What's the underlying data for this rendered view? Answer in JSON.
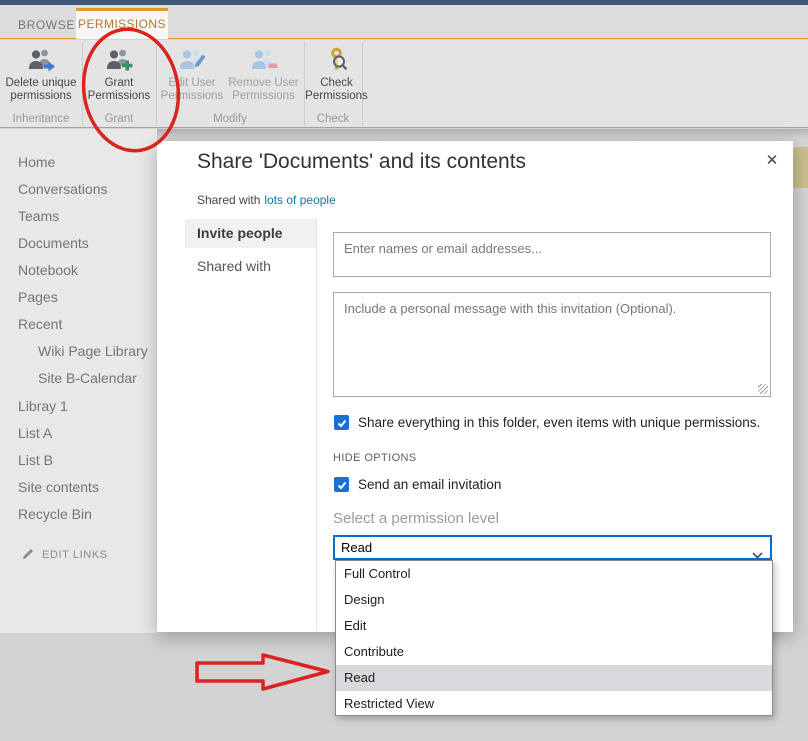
{
  "ribbon": {
    "tabs": [
      {
        "label": "BROWSE",
        "active": false
      },
      {
        "label": "PERMISSIONS",
        "active": true
      }
    ],
    "buttons": [
      {
        "label": "Delete unique\npermissions",
        "icon": "delete-unique-permissions-icon",
        "enabled": true
      },
      {
        "label": "Grant\nPermissions",
        "icon": "grant-permissions-icon",
        "enabled": true
      },
      {
        "label": "Edit User\nPermissions",
        "icon": "edit-user-permissions-icon",
        "enabled": false
      },
      {
        "label": "Remove User\nPermissions",
        "icon": "remove-user-permissions-icon",
        "enabled": false
      },
      {
        "label": "Check\nPermissions",
        "icon": "check-permissions-icon",
        "enabled": true
      }
    ],
    "groups": [
      {
        "label": "Inheritance"
      },
      {
        "label": "Grant"
      },
      {
        "label": "Modify"
      },
      {
        "label": "Check"
      }
    ]
  },
  "sidebar": {
    "items": [
      {
        "label": "Home"
      },
      {
        "label": "Conversations"
      },
      {
        "label": "Teams"
      },
      {
        "label": "Documents"
      },
      {
        "label": "Notebook"
      },
      {
        "label": "Pages"
      },
      {
        "label": "Recent"
      },
      {
        "label": "Wiki Page Library",
        "indent": true
      },
      {
        "label": "Site B-Calendar",
        "indent": true
      },
      {
        "label": "Libray 1"
      },
      {
        "label": "List A"
      },
      {
        "label": "List B"
      },
      {
        "label": "Site contents"
      },
      {
        "label": "Recycle Bin"
      }
    ],
    "edit_links_label": "EDIT LINKS"
  },
  "dialog": {
    "title": "Share 'Documents' and its contents",
    "close_label": "✕",
    "shared_with_prefix": "Shared with",
    "shared_with_link": "lots of people",
    "nav": [
      {
        "label": "Invite people",
        "active": true
      },
      {
        "label": "Shared with",
        "active": false
      }
    ],
    "name_input_placeholder": "Enter names or email addresses...",
    "message_placeholder": "Include a personal message with this invitation (Optional).",
    "checkbox_share_everything": {
      "label": "Share everything in this folder, even items with unique permissions.",
      "checked": true
    },
    "hide_options_label": "HIDE OPTIONS",
    "checkbox_send_email": {
      "label": "Send an email invitation",
      "checked": true
    },
    "permission_label": "Select a permission level",
    "select_value": "Read",
    "dropdown_options": [
      {
        "label": "Full Control",
        "selected": false
      },
      {
        "label": "Design",
        "selected": false
      },
      {
        "label": "Edit",
        "selected": false
      },
      {
        "label": "Contribute",
        "selected": false
      },
      {
        "label": "Read",
        "selected": true
      },
      {
        "label": "Restricted View",
        "selected": false
      }
    ]
  },
  "colors": {
    "suite_bar": "#3d5977",
    "ribbon_accent_orange": "#d89c30",
    "active_tab_text": "#b5772e",
    "link_teal": "#0e76a8",
    "checkbox_blue": "#1a6fd4",
    "select_focus_blue": "#0d6bcd",
    "dropdown_highlight": "#d8d9dc",
    "annotation_red": "#da2420"
  }
}
